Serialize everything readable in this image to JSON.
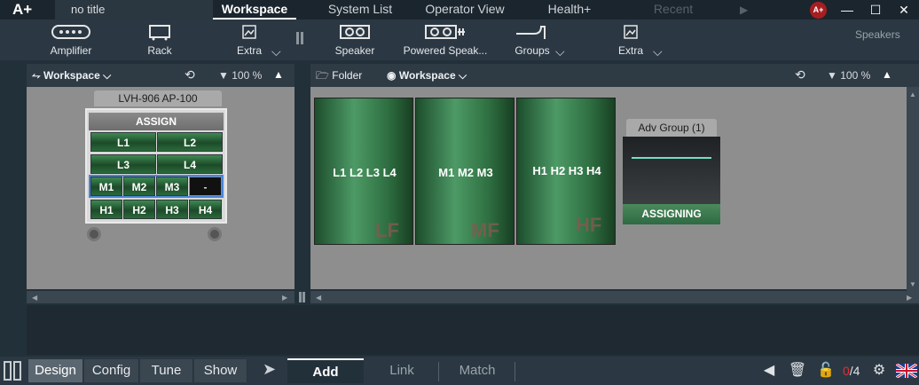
{
  "app": {
    "logo": "A+",
    "doc_title": "no title",
    "tabs": [
      {
        "label": "Workspace",
        "state": "active"
      },
      {
        "label": "System List",
        "state": "normal"
      },
      {
        "label": "Operator View",
        "state": "normal"
      },
      {
        "label": "Health+",
        "state": "normal"
      },
      {
        "label": "Recent",
        "state": "disabled"
      }
    ],
    "badge": "A+"
  },
  "toolbar_left": {
    "amplifier": "Amplifier",
    "rack": "Rack",
    "extra": "Extra"
  },
  "toolbar_right": {
    "speaker": "Speaker",
    "powered": "Powered Speak...",
    "groups": "Groups",
    "extra": "Extra",
    "section": "Speakers"
  },
  "left_pane": {
    "workspace_label": "Workspace",
    "zoom": "100 %",
    "rack": {
      "name": "LVH-906 AP-100",
      "assign": "ASSIGN",
      "row1": [
        "L1",
        "L2"
      ],
      "row2": [
        "L3",
        "L4"
      ],
      "row3": [
        "M1",
        "M2",
        "M3",
        "-"
      ],
      "row4": [
        "H1",
        "H2",
        "H3",
        "H4"
      ]
    }
  },
  "right_pane": {
    "folder_label": "Folder",
    "workspace_label": "Workspace",
    "zoom": "100 %",
    "groups": [
      {
        "label": "L1 L2 L3 L4",
        "tag": "LF"
      },
      {
        "label": "M1 M2 M3",
        "tag": "MF"
      },
      {
        "label": "H1 H2 H3 H4",
        "tag": "HF"
      }
    ],
    "adv_group": {
      "title": "Adv Group (1)",
      "status": "ASSIGNING"
    }
  },
  "bottom": {
    "modes": [
      "Design",
      "Config",
      "Tune",
      "Show"
    ],
    "active_mode": "Design",
    "subtabs": [
      "Add",
      "Link",
      "Match"
    ],
    "active_subtab": "Add",
    "counter_current": "0",
    "counter_total": "/4"
  },
  "colors": {
    "accent_green": "#3e8a52",
    "adv_line": "#6fe0c6",
    "badge_red": "#a61e22",
    "counter_red": "#e03030"
  }
}
